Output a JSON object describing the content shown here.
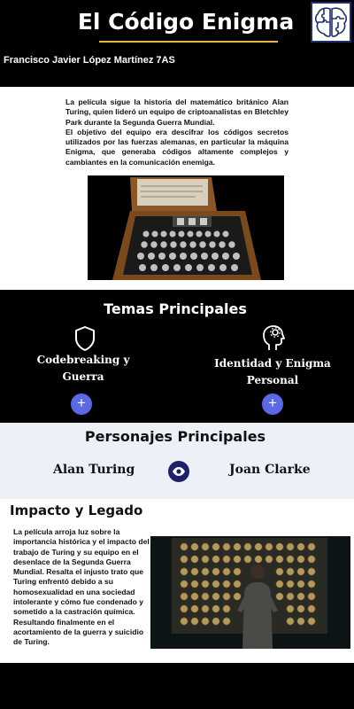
{
  "header": {
    "title": "El Código Enigma",
    "author": "Francisco Javier López Martínez  7AS"
  },
  "intro": {
    "paragraph_1": "La película sigue la historia del matemático británico Alan Turing, quien lideró un equipo de criptoanalistas en Bletchley Park durante la Segunda Guerra Mundial.",
    "paragraph_2": "El objetivo del equipo era descifrar los códigos secretos utilizados por las fuerzas alemanas, en particular la máquina Enigma, que generaba códigos altamente complejos y cambiantes en la comunicación enemiga."
  },
  "themes": {
    "title": "Temas Principales",
    "items": [
      {
        "label": "Codebreaking y Guerra",
        "icon": "shield-icon"
      },
      {
        "label": "Identidad y Enigma Personal",
        "icon": "head-gear-icon"
      }
    ],
    "plus_symbol": "+"
  },
  "characters": {
    "title": "Personajes Principales",
    "left_name": "Alan Turing",
    "right_name": "Joan Clarke",
    "center_icon": "eye-icon"
  },
  "impact": {
    "title": "Impacto y Legado",
    "paragraph_1": "La película arroja luz sobre la importancia histórica y el impacto del trabajo de Turing y su equipo en el desenlace de la Segunda Guerra Mundial. Resalta el injusto trato que Turing enfrentó debido a su homosexualidad en una sociedad intolerante y cómo fue condenado y sometido a la castración química.",
    "paragraph_2": "Resultando finalmente en el acortamiento de la guerra y suicidio de Turing."
  },
  "colors": {
    "background": "#000000",
    "title_underline": "#e6b84a",
    "plus_button": "#5b69e6",
    "eye_button": "#1e2068",
    "characters_bg": "#eef0f7"
  }
}
